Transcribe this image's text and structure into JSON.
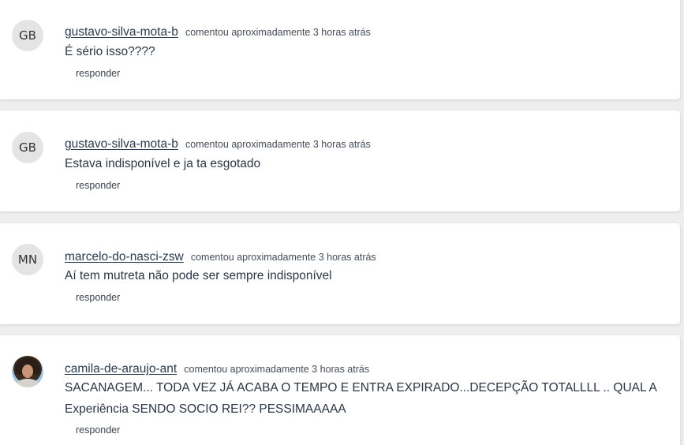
{
  "comments": [
    {
      "avatar_initials": "GB",
      "username": "gustavo-silva-mota-b",
      "action": "comentou aproximadamente 3 horas atrás",
      "text": "É sério isso????",
      "reply_label": "responder"
    },
    {
      "avatar_initials": "GB",
      "username": "gustavo-silva-mota-b",
      "action": "comentou aproximadamente 3 horas atrás",
      "text": "Estava indisponível e ja ta esgotado",
      "reply_label": "responder"
    },
    {
      "avatar_initials": "MN",
      "username": "marcelo-do-nasci-zsw",
      "action": "comentou aproximadamente 3 horas atrás",
      "text": "Aí tem mutreta não pode ser sempre indisponível",
      "reply_label": "responder"
    },
    {
      "avatar_initials": "",
      "avatar_type": "photo",
      "username": "camila-de-araujo-ant",
      "action": "comentou aproximadamente 3 horas atrás",
      "text": "SACANAGEM... TODA VEZ JÁ ACABA O TEMPO E ENTRA EXPIRADO...DECEPÇÃO TOTALLLL .. QUAL A Experiência SENDO SOCIO REI?? PESSIMAAAAA",
      "reply_label": "responder"
    }
  ]
}
